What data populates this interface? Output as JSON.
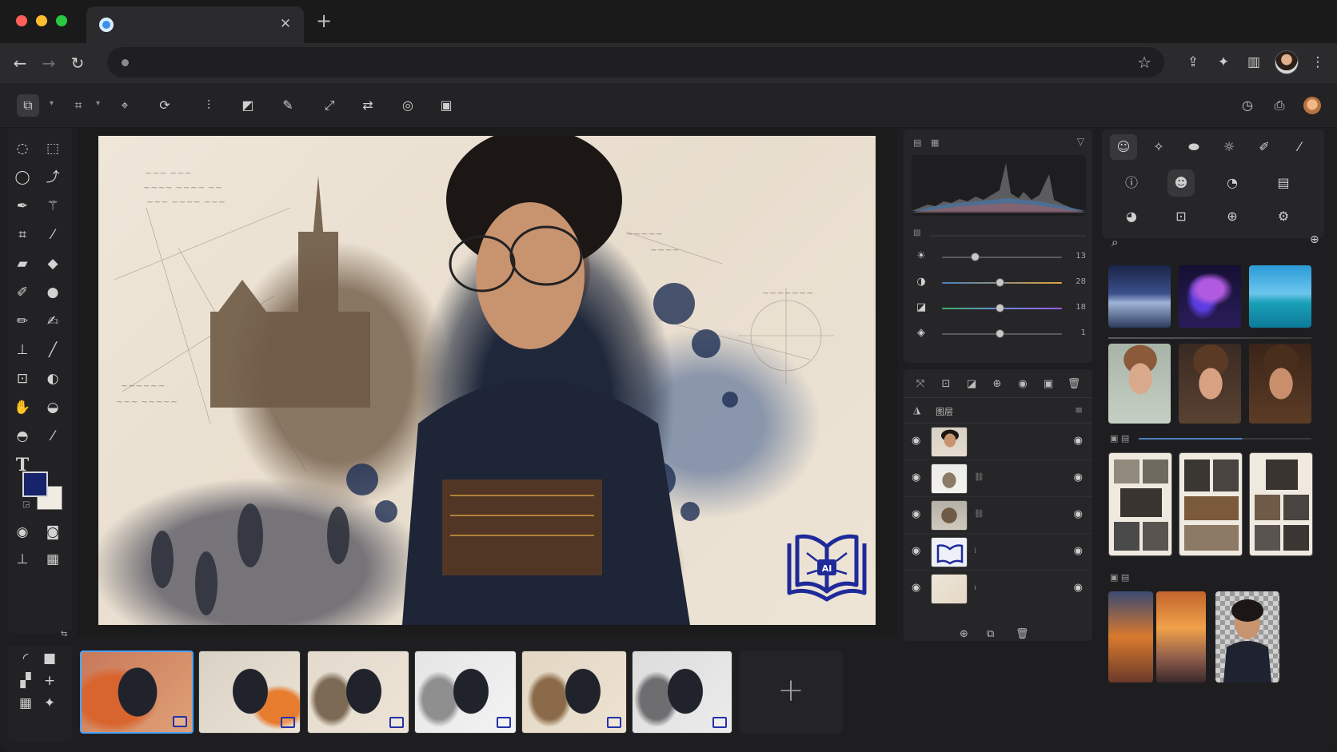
{
  "browser": {
    "tab_close": "✕",
    "new_tab": "+",
    "back": "←",
    "forward": "→",
    "reload": "↻",
    "star": "☆"
  },
  "layers": {
    "header_label": "图层"
  },
  "adjustments": [
    {
      "icon": "brightness-icon",
      "value": "13",
      "fraction": 0.27,
      "color": "#8a8a8a"
    },
    {
      "icon": "contrast-icon",
      "value": "28",
      "fraction": 0.48,
      "color": "#e0a23a"
    },
    {
      "icon": "saturation-icon",
      "value": "18",
      "fraction": 0.48,
      "color": "#9b5de5"
    },
    {
      "icon": "exposure-icon",
      "value": "1",
      "fraction": 0.48,
      "color": "#777777"
    }
  ],
  "canvas": {
    "logo_text": "AI"
  },
  "filmstrip": {
    "add_label": "+"
  },
  "colors": {
    "accent": "#4da3ff",
    "foreground_swatch": "#17236a",
    "background_swatch": "#f1ece2",
    "logo_blue": "#1f2a9a"
  },
  "toolbox": {
    "text_tool_label": "T"
  }
}
